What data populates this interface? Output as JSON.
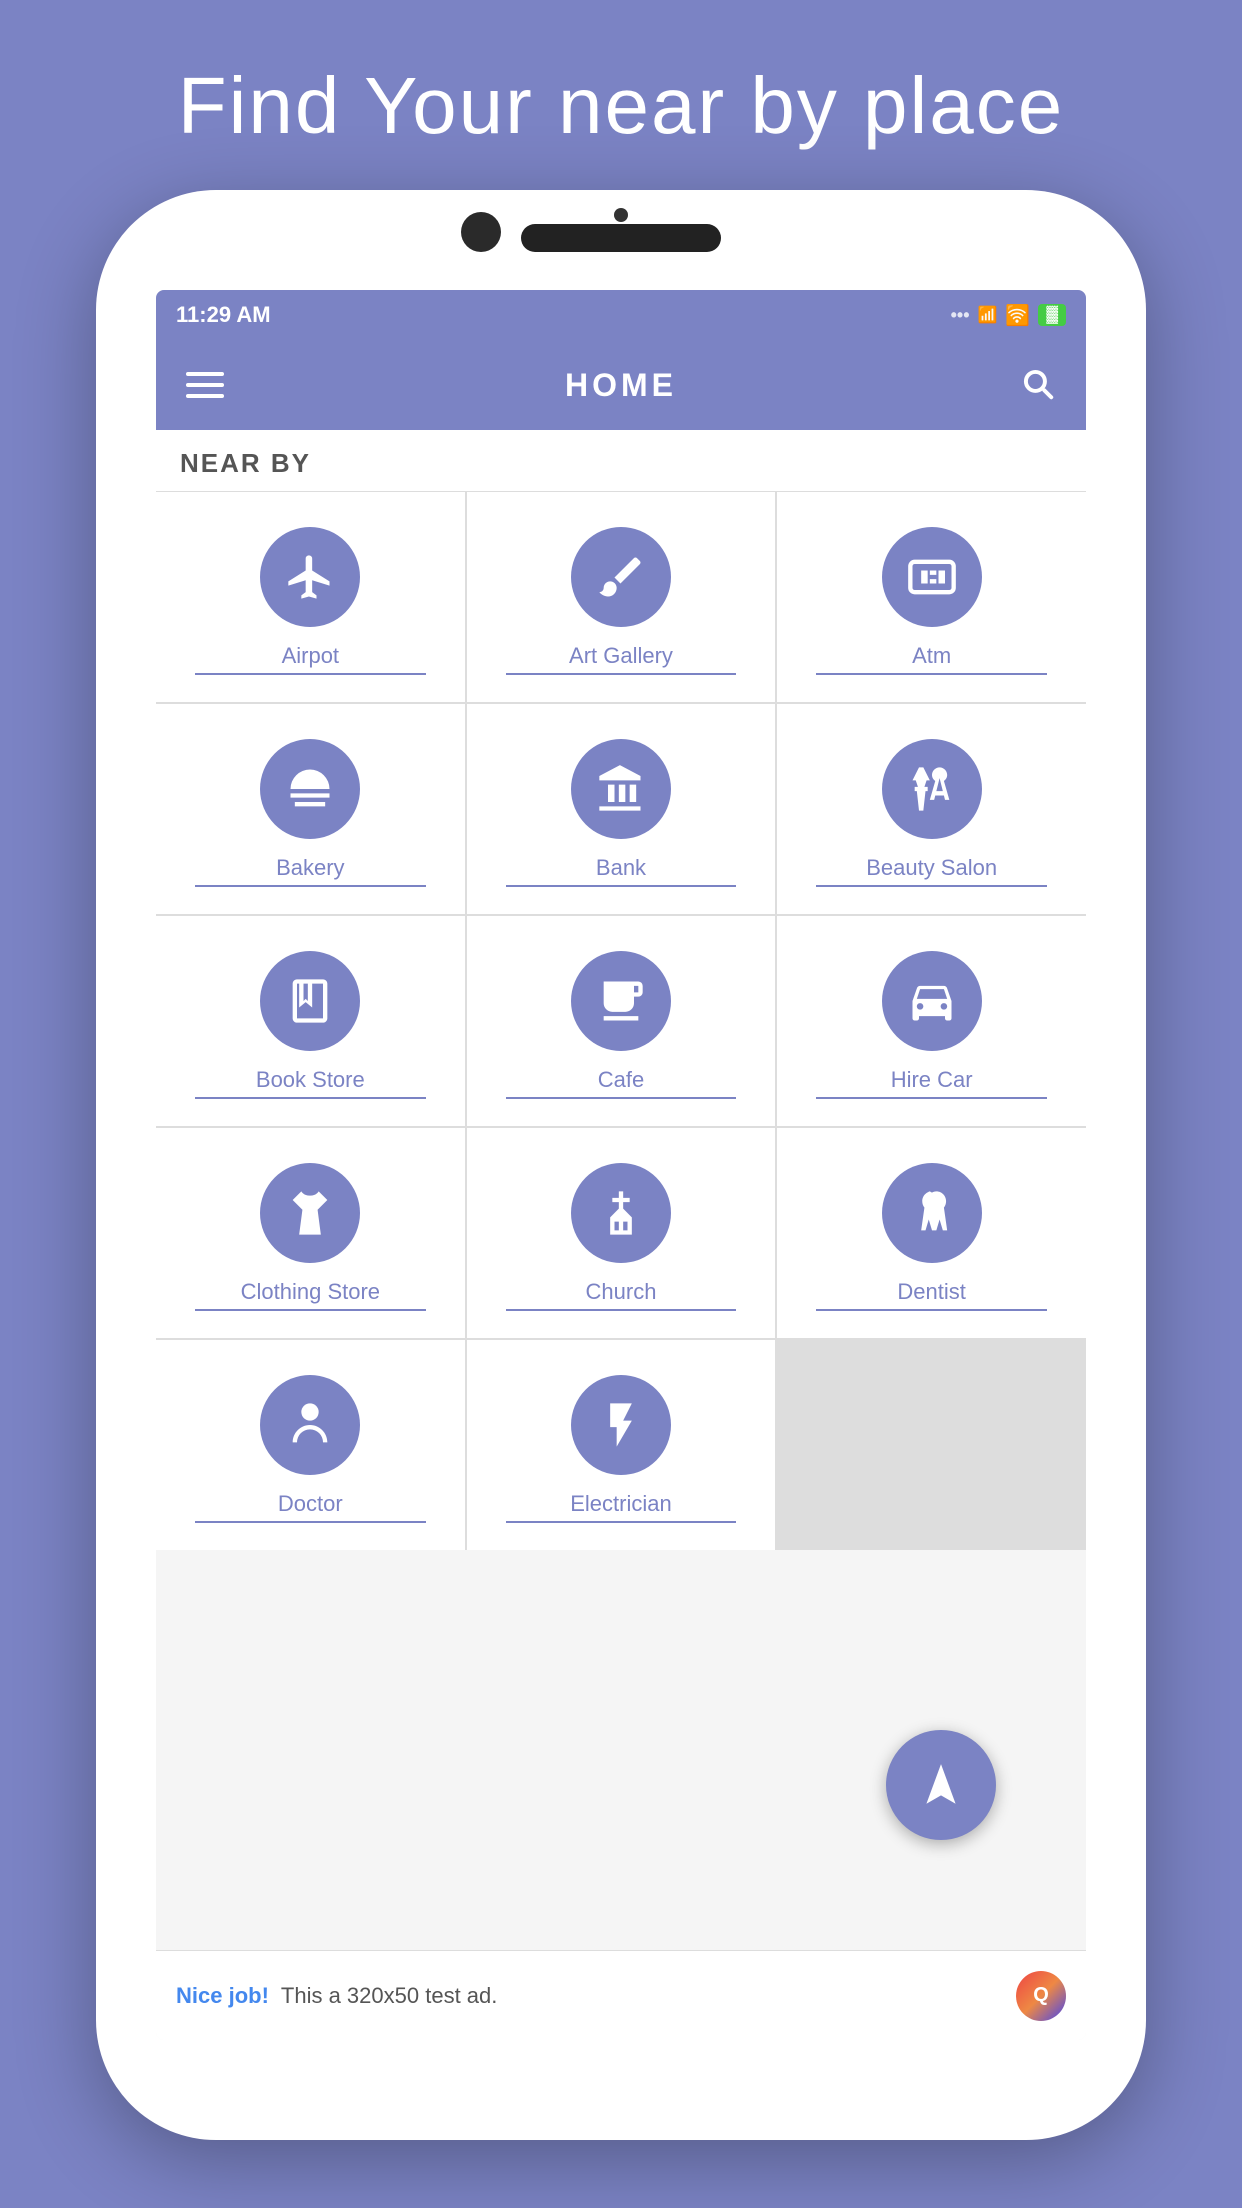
{
  "page": {
    "background_color": "#7B83C4",
    "header_text": "Find Your near by place"
  },
  "status_bar": {
    "time": "11:29 AM",
    "dots_label": "...",
    "battery_label": "🔋"
  },
  "app_header": {
    "title": "HOME",
    "hamburger_label": "menu",
    "search_label": "search"
  },
  "section": {
    "label": "NEAR BY"
  },
  "grid_items": [
    {
      "id": "airpot",
      "label": "Airpot",
      "icon": "✈"
    },
    {
      "id": "art_gallery",
      "label": "Art Gallery",
      "icon": "🎨"
    },
    {
      "id": "atm",
      "label": "Atm",
      "icon": "🏧"
    },
    {
      "id": "bakery",
      "label": "Bakery",
      "icon": "🧁"
    },
    {
      "id": "bank",
      "label": "Bank",
      "icon": "🏦"
    },
    {
      "id": "beauty_salon",
      "label": "Beauty Salon",
      "icon": "✂"
    },
    {
      "id": "book_store",
      "label": "Book Store",
      "icon": "📖"
    },
    {
      "id": "cafe",
      "label": "Cafe",
      "icon": "☕"
    },
    {
      "id": "hire_car",
      "label": "Hire Car",
      "icon": "🚗"
    },
    {
      "id": "clothing_store",
      "label": "Clothing Store",
      "icon": "👕"
    },
    {
      "id": "church",
      "label": "Church",
      "icon": "⛪"
    },
    {
      "id": "dentist",
      "label": "Dentist",
      "icon": "🦷"
    },
    {
      "id": "doctor",
      "label": "Doctor",
      "icon": "👨‍⚕️"
    },
    {
      "id": "electrician",
      "label": "Electrician",
      "icon": "⚡"
    }
  ],
  "fab": {
    "label": "navigate"
  },
  "ad_banner": {
    "nice_job": "Nice job!",
    "text": "This a 320x50 test ad.",
    "logo_label": "Q"
  }
}
